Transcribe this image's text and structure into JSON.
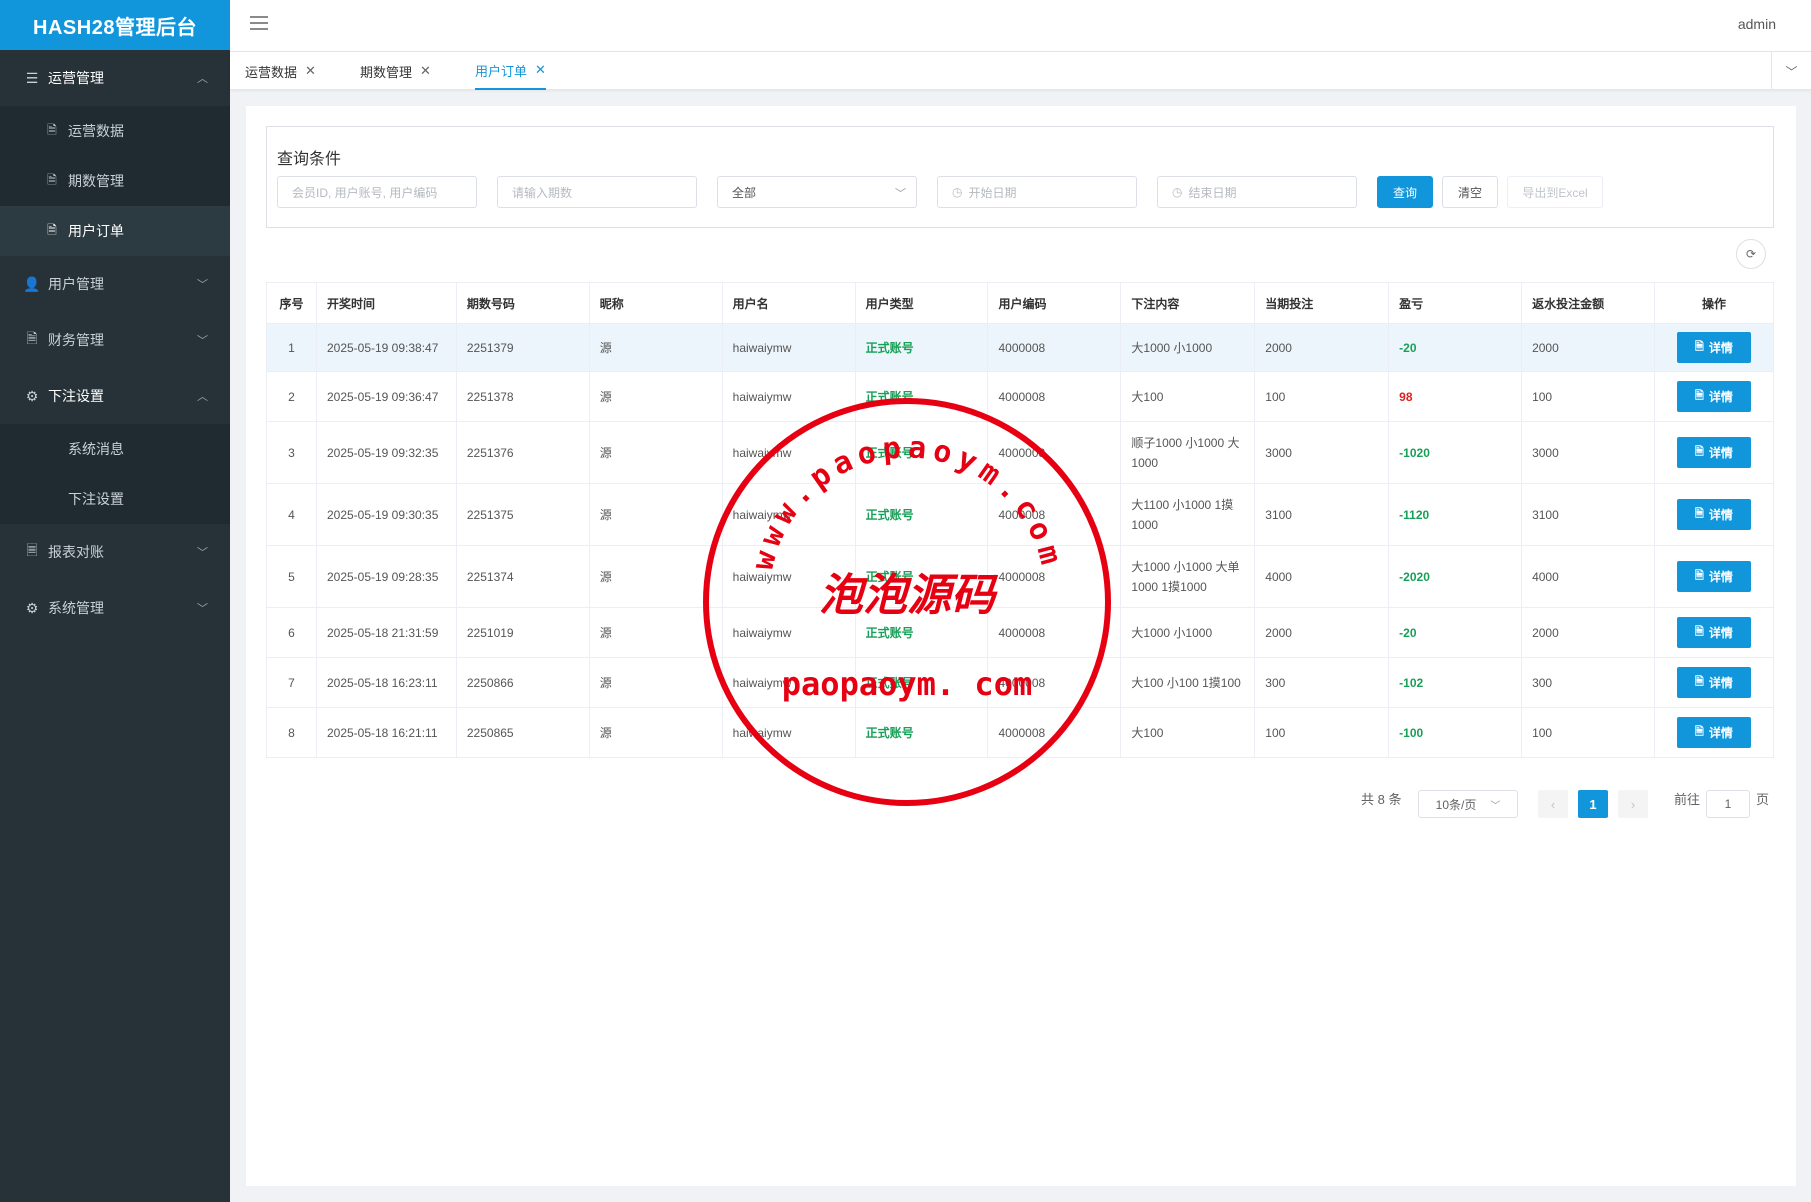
{
  "app": {
    "logo": "HASH28管理后台",
    "user": "admin"
  },
  "sidebar": {
    "groups": [
      {
        "label": "运营管理",
        "expanded": true,
        "items": [
          "运营数据",
          "期数管理",
          "用户订单"
        ]
      },
      {
        "label": "用户管理"
      },
      {
        "label": "财务管理"
      },
      {
        "label": "下注设置",
        "expanded": true,
        "items": [
          "系统消息",
          "下注设置"
        ]
      },
      {
        "label": "报表对账"
      },
      {
        "label": "系统管理"
      }
    ],
    "active_item": "用户订单"
  },
  "tabs": [
    {
      "label": "运营数据"
    },
    {
      "label": "期数管理"
    },
    {
      "label": "用户订单",
      "active": true
    }
  ],
  "query": {
    "title": "查询条件",
    "member_placeholder": "会员ID, 用户账号, 用户编码",
    "issue_placeholder": "请输入期数",
    "type_select": "全部",
    "start_placeholder": "开始日期",
    "end_placeholder": "结束日期",
    "search_btn": "查询",
    "clear_btn": "清空",
    "export_btn": "导出到Excel"
  },
  "table": {
    "headers": [
      "序号",
      "开奖时间",
      "期数号码",
      "昵称",
      "用户名",
      "用户类型",
      "用户编码",
      "下注内容",
      "当期投注",
      "盈亏",
      "返水投注金额",
      "操作"
    ],
    "detail_label": "详情",
    "rows": [
      {
        "no": "1",
        "time": "2025-05-19 09:38:47",
        "issue": "2251379",
        "nick": "源",
        "user": "haiwaiymw",
        "type": "正式账号",
        "code": "4000008",
        "content": "大1000 小1000",
        "bet": "2000",
        "pl": "-20",
        "pl_color": "green",
        "rebate": "2000"
      },
      {
        "no": "2",
        "time": "2025-05-19 09:36:47",
        "issue": "2251378",
        "nick": "源",
        "user": "haiwaiymw",
        "type": "正式账号",
        "code": "4000008",
        "content": "大100",
        "bet": "100",
        "pl": "98",
        "pl_color": "red",
        "rebate": "100"
      },
      {
        "no": "3",
        "time": "2025-05-19 09:32:35",
        "issue": "2251376",
        "nick": "源",
        "user": "haiwaiymw",
        "type": "正式账号",
        "code": "4000008",
        "content": "顺子1000 小1000 大1000",
        "bet": "3000",
        "pl": "-1020",
        "pl_color": "green",
        "rebate": "3000"
      },
      {
        "no": "4",
        "time": "2025-05-19 09:30:35",
        "issue": "2251375",
        "nick": "源",
        "user": "haiwaiymw",
        "type": "正式账号",
        "code": "4000008",
        "content": "大1100 小1000 1摸1000",
        "bet": "3100",
        "pl": "-1120",
        "pl_color": "green",
        "rebate": "3100"
      },
      {
        "no": "5",
        "time": "2025-05-19 09:28:35",
        "issue": "2251374",
        "nick": "源",
        "user": "haiwaiymw",
        "type": "正式账号",
        "code": "4000008",
        "content": "大1000 小1000 大单1000 1摸1000",
        "bet": "4000",
        "pl": "-2020",
        "pl_color": "green",
        "rebate": "4000"
      },
      {
        "no": "6",
        "time": "2025-05-18 21:31:59",
        "issue": "2251019",
        "nick": "源",
        "user": "haiwaiymw",
        "type": "正式账号",
        "code": "4000008",
        "content": "大1000 小1000",
        "bet": "2000",
        "pl": "-20",
        "pl_color": "green",
        "rebate": "2000"
      },
      {
        "no": "7",
        "time": "2025-05-18 16:23:11",
        "issue": "2250866",
        "nick": "源",
        "user": "haiwaiymw",
        "type": "正式账号",
        "code": "4000008",
        "content": "大100 小100 1摸100",
        "bet": "300",
        "pl": "-102",
        "pl_color": "green",
        "rebate": "300"
      },
      {
        "no": "8",
        "time": "2025-05-18 16:21:11",
        "issue": "2250865",
        "nick": "源",
        "user": "haiwaiymw",
        "type": "正式账号",
        "code": "4000008",
        "content": "大100",
        "bet": "100",
        "pl": "-100",
        "pl_color": "green",
        "rebate": "100"
      }
    ]
  },
  "pagination": {
    "total": "共 8 条",
    "page_size": "10条/页",
    "current": "1",
    "goto_label": "前往",
    "goto_value": "1",
    "page_suffix": "页"
  },
  "watermark": {
    "top_text": "www.paopaoym.com",
    "center_text": "泡泡源码",
    "bottom_text": "paopaoym. com"
  },
  "colors": {
    "brand": "#1296db",
    "sidebar": "#263238",
    "profit_green": "#18a058",
    "profit_red": "#e02020",
    "stamp": "#e60012"
  }
}
